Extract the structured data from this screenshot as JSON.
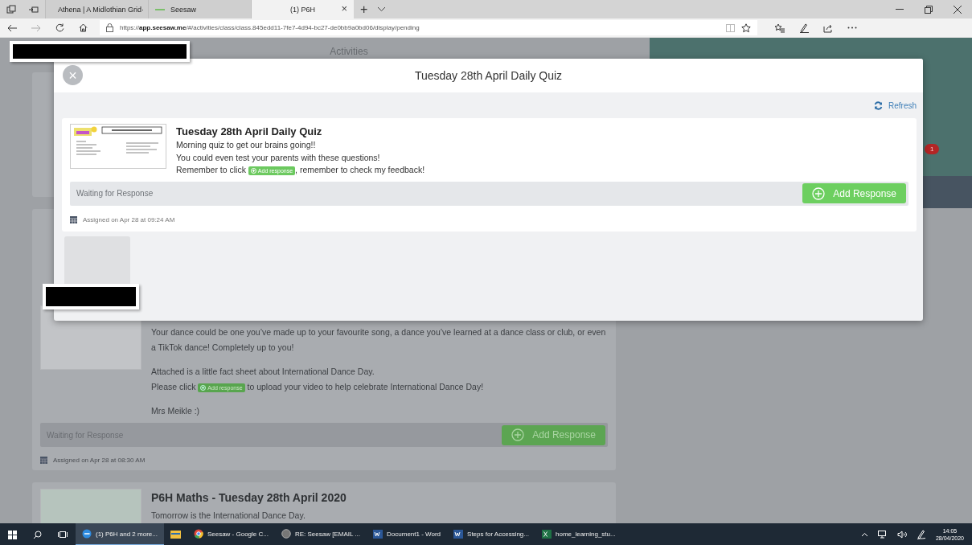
{
  "browser": {
    "tabs": [
      {
        "label": "Athena | A Midlothian Grid·",
        "selected": false,
        "kind": "window"
      },
      {
        "label": "Seesaw",
        "selected": false,
        "kind": "seesaw"
      },
      {
        "label": "(1) P6H",
        "selected": true,
        "kind": "blank"
      }
    ],
    "tab_close": "×",
    "new_tab": "+",
    "url": "https://**app.seesaw.me**/#/activities/class/class.845edd11-7fe7-4d94-bc27-de0bb9a0bd06/display/pending"
  },
  "page": {
    "header": "Activities",
    "badge": "1",
    "activities": [
      {
        "paragraphs": [
          {
            "lines": [
              [
                {
                  "kind": "text",
                  "text": "Your dance could be one you’ve made up to your favourite song, a dance you’ve learned at a dance class or club, or even a TikTok dance! Completely up to you!"
                }
              ]
            ]
          },
          {
            "lines": [
              [
                {
                  "kind": "text",
                  "text": "Attached is a little fact sheet about International Dance Day."
                }
              ],
              [
                {
                  "kind": "text",
                  "text": "Please click "
                },
                {
                  "kind": "chip",
                  "text": "Add response"
                },
                {
                  "kind": "text",
                  "text": " to upload your video to help celebrate International Dance Day!"
                }
              ]
            ]
          },
          {
            "lines": [
              [
                {
                  "kind": "text",
                  "text": "Mrs Meikle :)"
                }
              ]
            ]
          }
        ],
        "status": "Waiting for Response",
        "button": "Add Response",
        "assigned": "Assigned on Apr 28 at 08:30 AM"
      },
      {
        "title": "P6H Maths - Tuesday 28th April 2020",
        "paragraphs": [
          {
            "lines": [
              [
                {
                  "kind": "text",
                  "text": "Tomorrow is the International Dance Day."
                }
              ]
            ]
          }
        ]
      }
    ]
  },
  "modal": {
    "close": "×",
    "title": "Tuesday 28th April Daily Quiz",
    "refresh": "Refresh",
    "card": {
      "title": "Tuesday 28th April Daily Quiz",
      "paragraphs": [
        {
          "lines": [
            [
              {
                "kind": "text",
                "text": "Morning quiz to get our brains going!!"
              }
            ],
            [
              {
                "kind": "text",
                "text": "You could even test your parents with these questions!"
              }
            ],
            [
              {
                "kind": "text",
                "text": "Remember to click "
              },
              {
                "kind": "chip",
                "text": "Add response"
              },
              {
                "kind": "text",
                "text": ", remember to check my feedback!"
              }
            ]
          ]
        }
      ],
      "status": "Waiting for Response",
      "button": "Add Response",
      "assigned": "Assigned on Apr 28 at 09:24 AM"
    }
  },
  "taskbar": {
    "items": [
      {
        "kind": "edge",
        "label": "(1) P6H and 2 more...",
        "selected": true
      },
      {
        "kind": "explorer",
        "selected": false
      },
      {
        "kind": "chrome",
        "label": "Seesaw - Google C...",
        "selected": false
      },
      {
        "kind": "mail",
        "label": "RE: Seesaw [EMAIL ...",
        "selected": false
      },
      {
        "kind": "word",
        "label": "Document1 - Word",
        "selected": false
      },
      {
        "kind": "word",
        "label": "Steps for Accessing...",
        "selected": false
      },
      {
        "kind": "excel",
        "label": "home_learning_stu...",
        "selected": false
      }
    ],
    "time": "14:05",
    "date": "28/04/2020"
  }
}
